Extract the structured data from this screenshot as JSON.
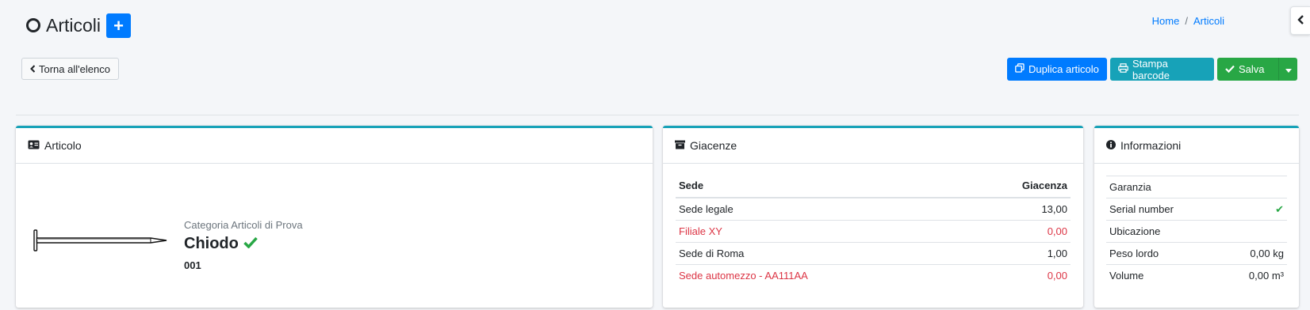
{
  "header": {
    "title": "Articoli",
    "add_button": "+",
    "breadcrumb": [
      "Home",
      "Articoli"
    ]
  },
  "toolbar": {
    "back_label": "Torna all'elenco",
    "duplicate_label": "Duplica articolo",
    "print_barcode_label": "Stampa barcode",
    "save_label": "Salva"
  },
  "articolo": {
    "heading": "Articolo",
    "category": "Categoria Articoli di Prova",
    "name": "Chiodo",
    "code": "001"
  },
  "giacenze": {
    "heading": "Giacenze",
    "columns": [
      "Sede",
      "Giacenza"
    ],
    "rows": [
      {
        "sede": "Sede legale",
        "giacenza": "13,00",
        "status": "ok"
      },
      {
        "sede": "Filiale XY",
        "giacenza": "0,00",
        "status": "zero"
      },
      {
        "sede": "Sede di Roma",
        "giacenza": "1,00",
        "status": "ok"
      },
      {
        "sede": "Sede automezzo - AA111AA",
        "giacenza": "0,00",
        "status": "zero"
      }
    ]
  },
  "informazioni": {
    "heading": "Informazioni",
    "rows": [
      {
        "label": "Garanzia",
        "value": ""
      },
      {
        "label": "Serial number",
        "value": "✔"
      },
      {
        "label": "Ubicazione",
        "value": ""
      },
      {
        "label": "Peso lordo",
        "value": "0,00 kg"
      },
      {
        "label": "Volume",
        "value": "0,00 m³"
      }
    ]
  },
  "colors": {
    "primary": "#007bff",
    "info": "#17a2b8",
    "success": "#28a745",
    "danger": "#dc3545"
  }
}
